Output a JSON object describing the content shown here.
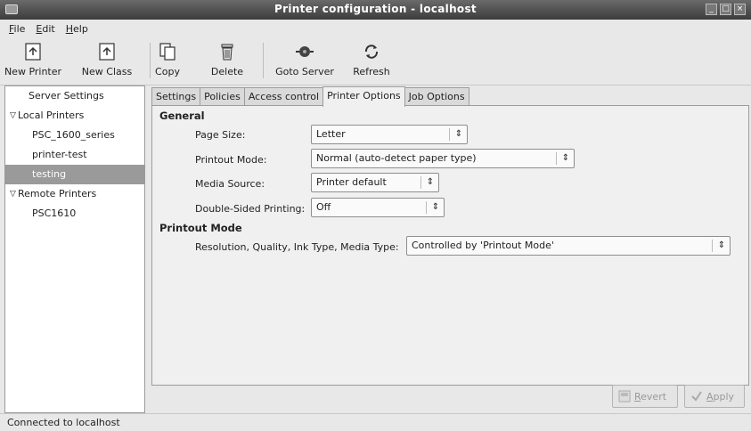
{
  "window": {
    "title": "Printer configuration - localhost",
    "controls": [
      "minimize",
      "maximize",
      "close"
    ]
  },
  "menubar": {
    "items": [
      {
        "label": "File",
        "mnemonic": "F",
        "rest": "ile"
      },
      {
        "label": "Edit",
        "mnemonic": "E",
        "rest": "dit"
      },
      {
        "label": "Help",
        "mnemonic": "H",
        "rest": "elp"
      }
    ]
  },
  "toolbar": {
    "buttons": [
      {
        "label": "New Printer",
        "icon": "new-printer-icon"
      },
      {
        "label": "New Class",
        "icon": "new-class-icon"
      },
      {
        "label": "Copy",
        "icon": "copy-icon"
      },
      {
        "label": "Delete",
        "icon": "delete-icon"
      },
      {
        "label": "Goto Server",
        "icon": "goto-server-icon"
      },
      {
        "label": "Refresh",
        "icon": "refresh-icon"
      }
    ]
  },
  "sidebar": {
    "items": [
      {
        "label": "Server Settings",
        "level": 0,
        "expander": false
      },
      {
        "label": "Local Printers",
        "level": 0,
        "expander": true
      },
      {
        "label": "PSC_1600_series",
        "level": 1,
        "expander": false
      },
      {
        "label": "printer-test",
        "level": 1,
        "expander": false
      },
      {
        "label": "testing",
        "level": 1,
        "expander": false,
        "selected": true
      },
      {
        "label": "Remote Printers",
        "level": 0,
        "expander": true
      },
      {
        "label": "PSC1610",
        "level": 1,
        "expander": false
      }
    ]
  },
  "tabs": [
    {
      "label": "Settings",
      "active": false
    },
    {
      "label": "Policies",
      "active": false
    },
    {
      "label": "Access control",
      "active": false
    },
    {
      "label": "Printer Options",
      "active": true
    },
    {
      "label": "Job Options",
      "active": false
    }
  ],
  "printer_options": {
    "general": {
      "title": "General",
      "page_size": {
        "label": "Page Size:",
        "value": "Letter"
      },
      "printout_mode": {
        "label": "Printout Mode:",
        "value": "Normal (auto-detect paper type)"
      },
      "media_source": {
        "label": "Media Source:",
        "value": "Printer default"
      },
      "double_sided": {
        "label": "Double-Sided Printing:",
        "value": "Off"
      }
    },
    "printout_mode_section": {
      "title": "Printout Mode",
      "resolution": {
        "label": "Resolution, Quality, Ink Type, Media Type:",
        "value": "Controlled by 'Printout Mode'"
      }
    }
  },
  "buttons": {
    "revert": {
      "label": "Revert",
      "mnemonic": "R",
      "rest": "evert",
      "enabled": false
    },
    "apply": {
      "label": "Apply",
      "mnemonic": "A",
      "rest": "pply",
      "enabled": false
    }
  },
  "status": {
    "text": "Connected to localhost"
  },
  "colors": {
    "selection": "#9a9a9a",
    "titlebar": "#4a4a4a",
    "panel": "#f0f0f0"
  }
}
